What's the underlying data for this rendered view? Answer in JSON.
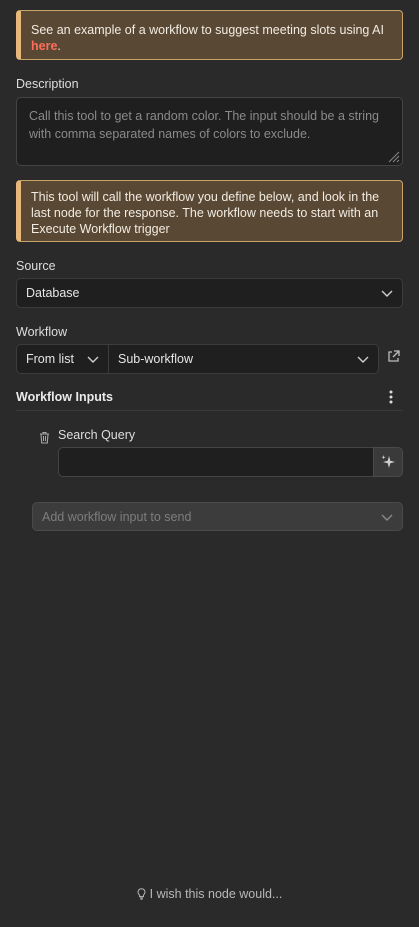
{
  "callout_example": {
    "text": "See an example of a workflow to suggest meeting slots using AI ",
    "link": "here",
    "suffix": "."
  },
  "description": {
    "label": "Description",
    "value": "Call this tool to get a random color. The input should be a string with comma separated names of colors to exclude."
  },
  "callout_info": {
    "text": "This tool will call the workflow you define below, and look in the last node for the response. The workflow needs to start with an Execute Workflow trigger"
  },
  "source": {
    "label": "Source",
    "value": "Database"
  },
  "workflow": {
    "label": "Workflow",
    "mode": "From list",
    "value": "Sub-workflow"
  },
  "workflow_inputs": {
    "title": "Workflow Inputs",
    "items": [
      {
        "label": "Search Query",
        "value": ""
      }
    ],
    "add_placeholder": "Add workflow input to send"
  },
  "feedback": {
    "label": "I wish this node would..."
  },
  "colors": {
    "background": "#2a2a2a",
    "callout_bg": "#594834",
    "callout_accent": "#e8b77a",
    "link": "#ff6d5a"
  }
}
